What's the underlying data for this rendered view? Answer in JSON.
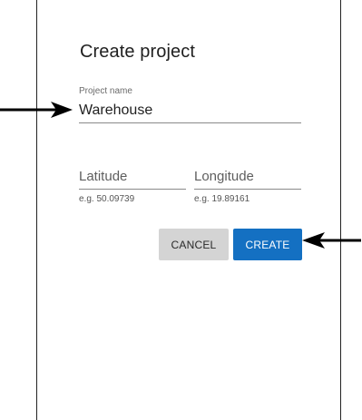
{
  "dialog": {
    "title": "Create project",
    "project_name": {
      "label": "Project name",
      "value": "Warehouse"
    },
    "latitude": {
      "placeholder": "Latitude",
      "hint": "e.g. 50.09739"
    },
    "longitude": {
      "placeholder": "Longitude",
      "hint": "e.g. 19.89161"
    },
    "buttons": {
      "cancel_label": "CANCEL",
      "create_label": "CREATE"
    }
  },
  "colors": {
    "primary": "#1470c2",
    "cancel_background": "#d4d4d4",
    "annotation_arrow": "#000000"
  },
  "annotations": {
    "arrow_1_icon": "right-arrow-icon",
    "arrow_2_icon": "left-arrow-icon"
  }
}
